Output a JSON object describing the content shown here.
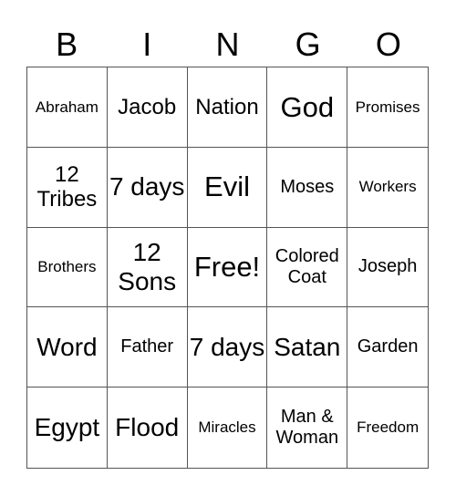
{
  "header": [
    "B",
    "I",
    "N",
    "G",
    "O"
  ],
  "cells": [
    {
      "text": "Abraham",
      "size": "s5"
    },
    {
      "text": "Jacob",
      "size": "s3"
    },
    {
      "text": "Nation",
      "size": "s3"
    },
    {
      "text": "God",
      "size": "s1"
    },
    {
      "text": "Promises",
      "size": "s5"
    },
    {
      "text": "12 Tribes",
      "size": "s3"
    },
    {
      "text": "7 days",
      "size": "s2"
    },
    {
      "text": "Evil",
      "size": "s1"
    },
    {
      "text": "Moses",
      "size": "s4"
    },
    {
      "text": "Workers",
      "size": "s5"
    },
    {
      "text": "Brothers",
      "size": "s5"
    },
    {
      "text": "12 Sons",
      "size": "s2"
    },
    {
      "text": "Free!",
      "size": "s1"
    },
    {
      "text": "Colored Coat",
      "size": "s4"
    },
    {
      "text": "Joseph",
      "size": "s4"
    },
    {
      "text": "Word",
      "size": "s2"
    },
    {
      "text": "Father",
      "size": "s4"
    },
    {
      "text": "7 days",
      "size": "s2"
    },
    {
      "text": "Satan",
      "size": "s2"
    },
    {
      "text": "Garden",
      "size": "s4"
    },
    {
      "text": "Egypt",
      "size": "s2"
    },
    {
      "text": "Flood",
      "size": "s2"
    },
    {
      "text": "Miracles",
      "size": "s5"
    },
    {
      "text": "Man & Woman",
      "size": "s4"
    },
    {
      "text": "Freedom",
      "size": "s5"
    }
  ]
}
